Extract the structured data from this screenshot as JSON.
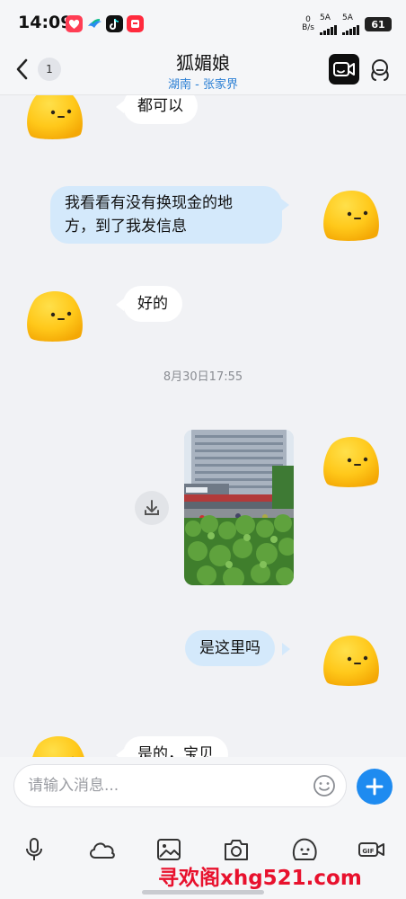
{
  "status_bar": {
    "time": "14:09",
    "net_speed_value": "0",
    "net_speed_unit": "B/s",
    "sim1": "5A",
    "sim2": "5A",
    "battery": "61",
    "app_icons": [
      "heart-app-icon",
      "bird-app-icon",
      "tiktok-icon",
      "red-app-icon"
    ]
  },
  "header": {
    "back_icon": "chevron-left-icon",
    "unread_count": "1",
    "contact_name": "狐媚娘",
    "location": "湖南 - 张家界",
    "video_icon": "video-call-icon",
    "profile_icon": "profile-icon"
  },
  "messages": [
    {
      "side": "incoming",
      "text": "都可以"
    },
    {
      "side": "outgoing",
      "text_line1": "我看看有没有换现金的地",
      "text_line2": "方，到了我发信息"
    },
    {
      "side": "incoming",
      "text": "好的"
    },
    {
      "type": "timestamp",
      "text": "8月30日17:55"
    },
    {
      "side": "outgoing",
      "type": "image",
      "content": "photo of building and hedge",
      "download_icon": "download-icon"
    },
    {
      "side": "outgoing",
      "text": "是这里吗"
    },
    {
      "side": "incoming",
      "text": "是的，宝贝"
    }
  ],
  "composer": {
    "placeholder": "请输入消息...",
    "emoji_icon": "smiley-icon",
    "plus_icon": "plus-icon"
  },
  "toolbar": {
    "icons": [
      "microphone-icon",
      "cloud-icon",
      "image-icon",
      "camera-icon",
      "sticker-face-icon",
      "gif-icon"
    ]
  },
  "watermark": "寻欢阁xhg521.com",
  "colors": {
    "accent": "#1e8bf0",
    "outgoing_bubble": "#d4e9fb",
    "incoming_bubble": "#ffffff",
    "location_text": "#2a7fd4",
    "watermark": "#e8112d"
  }
}
